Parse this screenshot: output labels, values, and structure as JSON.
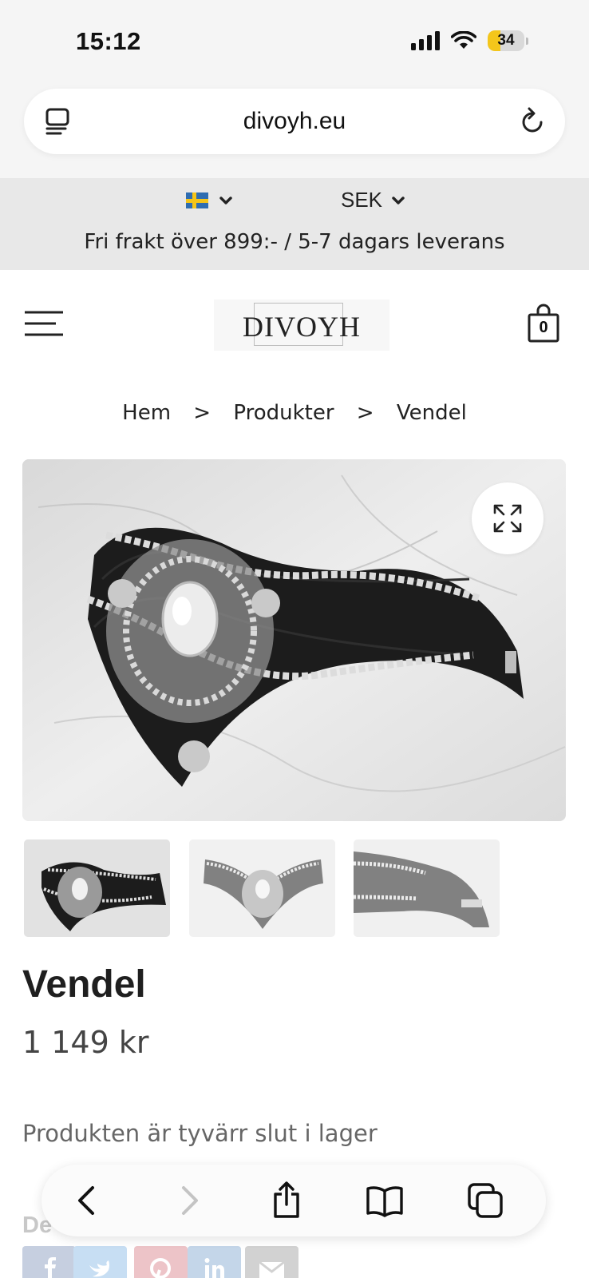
{
  "status_bar": {
    "time": "15:12",
    "battery_level": "34",
    "battery_fraction": 0.34
  },
  "browser": {
    "url": "divoyh.eu",
    "icons": {
      "reader": "reader-icon",
      "reload": "reload-icon"
    },
    "toolbar": {
      "back": "back-icon",
      "forward": "forward-icon",
      "share": "share-icon",
      "bookmarks": "book-icon",
      "tabs": "tabs-icon"
    }
  },
  "topbar": {
    "language_flag": "sweden-flag",
    "currency": "SEK",
    "shipping_notice": "Fri frakt över 899:- / 5-7 dagars leverans"
  },
  "header": {
    "logo_text": "DIVOYH",
    "cart_count": "0"
  },
  "breadcrumb": {
    "items": [
      "Hem",
      "Produkter",
      "Vendel"
    ],
    "separator": ">"
  },
  "product": {
    "title": "Vendel",
    "price": "1 149 kr",
    "stock_message": "Produkten är tyvärr slut i lager",
    "share_label": "De",
    "thumbnails_count": 3
  },
  "share_buttons": [
    "facebook-icon",
    "twitter-icon",
    "pinterest-icon",
    "linkedin-icon",
    "email-icon"
  ],
  "colors": {
    "page_bg": "#ffffff",
    "topbar_bg": "#e8e8e8",
    "browser_chrome": "#f5f5f5",
    "battery_yellow": "#f4c61b"
  }
}
